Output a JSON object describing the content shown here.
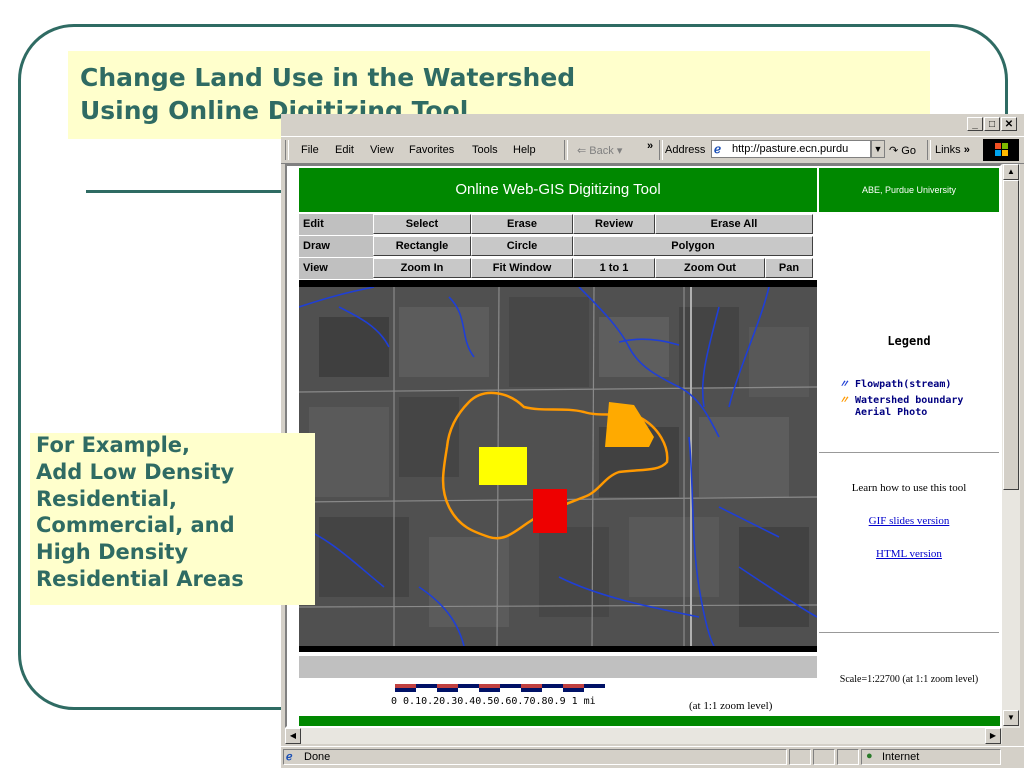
{
  "slide": {
    "title_line1": "Change Land Use in the Watershed",
    "title_line2": "Using Online Digitizing Tool",
    "callout_lines": [
      "For Example,",
      "Add Low Density",
      "Residential,",
      "Commercial, and",
      "High Density",
      "Residential Areas"
    ],
    "colors": {
      "theme": "#2f6b63",
      "highlight": "#ffffcc"
    }
  },
  "browser": {
    "menu": [
      "File",
      "Edit",
      "View",
      "Favorites",
      "Tools",
      "Help"
    ],
    "back_label": "Back",
    "chevron": "»",
    "address_label": "Address",
    "address_value": "http://pasture.ecn.purdu",
    "go_label": "Go",
    "links_label": "Links",
    "status_text": "Done",
    "zone_text": "Internet"
  },
  "tool": {
    "title": "Online Web-GIS Digitizing Tool",
    "org": "ABE, Purdue University",
    "rows": [
      {
        "label": "Edit",
        "buttons": [
          "Select",
          "Erase",
          "Review",
          "Erase All"
        ]
      },
      {
        "label": "Draw",
        "buttons": [
          "Rectangle",
          "Circle",
          "Polygon"
        ]
      },
      {
        "label": "View",
        "buttons": [
          "Zoom In",
          "Fit Window",
          "1 to 1",
          "Zoom Out",
          "Pan"
        ]
      }
    ],
    "legend": {
      "title": "Legend",
      "items": [
        "Flowpath(stream)",
        "Watershed boundary",
        "Aerial Photo"
      ]
    },
    "learn_text": "Learn how to use this tool",
    "links": [
      "GIF slides version",
      "HTML version"
    ],
    "scale_numbers": "0 0.10.20.30.40.50.60.70.80.9 1 mi",
    "zoom_note": "(at 1:1 zoom level)",
    "scale_right": "Scale=1:22700 (at 1:1 zoom level)",
    "colors": {
      "green": "#008800",
      "stream": "#1f3fd6",
      "boundary": "#ff9900",
      "low_density": "#ffff00",
      "commercial": "#ffaa00",
      "high_density": "#ee0000"
    }
  }
}
